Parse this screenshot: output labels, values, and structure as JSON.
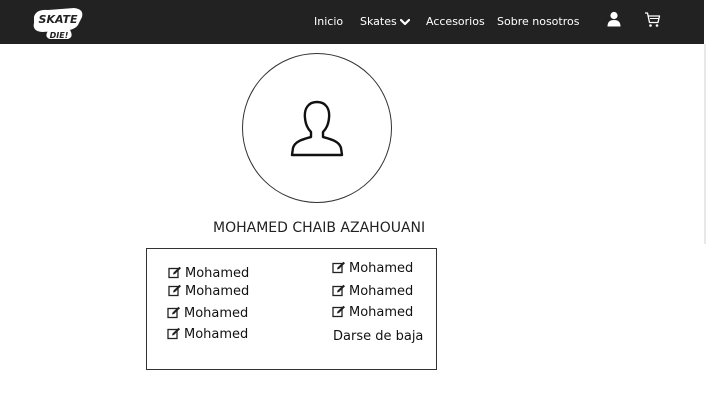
{
  "brand": {
    "logo_text_line1": "Skate",
    "logo_text_line2": "or Die!"
  },
  "nav": {
    "items": [
      {
        "label": "Inicio"
      },
      {
        "label": "Skates"
      },
      {
        "label": "Accesorios"
      },
      {
        "label": "Sobre nosotros"
      }
    ],
    "user_icon": "user-icon",
    "cart_icon": "cart-icon"
  },
  "profile": {
    "avatar_icon": "person-silhouette-icon",
    "name": "MOHAMED CHAIB AZAHOUANI"
  },
  "options": {
    "left": [
      "Mohamed",
      "Mohamed",
      "Mohamed",
      "Mohamed"
    ],
    "right": [
      "Mohamed",
      "Mohamed",
      "Mohamed"
    ],
    "unsubscribe": "Darse de baja",
    "edit_icon": "edit-icon"
  }
}
